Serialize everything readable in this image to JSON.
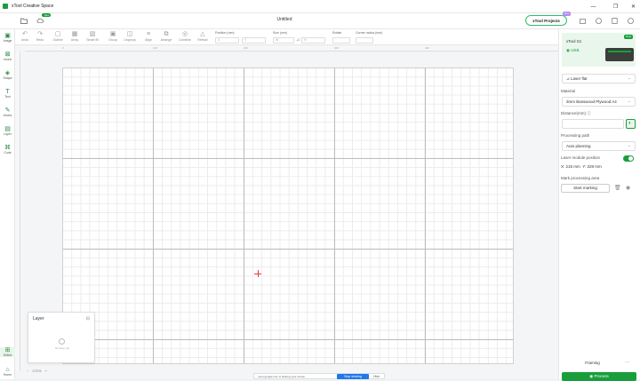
{
  "app": {
    "title": "xTool Creative Space",
    "doc_title": "Untitled",
    "new_badge": "New",
    "projects_label": "xTool Projects",
    "hot_badge": "Hot"
  },
  "window_controls": [
    "—",
    "❐",
    "✕"
  ],
  "toolbar": {
    "items": [
      {
        "label": "Undo",
        "icon": "undo-icon"
      },
      {
        "label": "Redo",
        "icon": "redo-icon"
      },
      {
        "label": "Outline",
        "icon": "outline-icon"
      },
      {
        "label": "Array",
        "icon": "array-icon"
      },
      {
        "label": "Smart fill",
        "icon": "smart-fill-icon"
      },
      {
        "label": "Group",
        "icon": "group-icon"
      },
      {
        "label": "Ungroup",
        "icon": "ungroup-icon"
      },
      {
        "label": "Align",
        "icon": "align-icon"
      },
      {
        "label": "Arrange",
        "icon": "arrange-icon"
      },
      {
        "label": "Combine",
        "icon": "combine-icon"
      },
      {
        "label": "Refract",
        "icon": "refract-icon"
      }
    ],
    "position_label": "Position (mm)",
    "position_x": "X",
    "position_y": "Y",
    "size_label": "Size (mm)",
    "size_w": "W",
    "size_h": "H",
    "rotate_label": "Rotate",
    "corner_label": "Corner radius (mm)"
  },
  "leftbar": {
    "items": [
      {
        "label": "Image",
        "icon": "image-icon"
      },
      {
        "label": "Insert",
        "icon": "insert-icon"
      },
      {
        "label": "Shape",
        "icon": "shape-icon"
      },
      {
        "label": "Text",
        "icon": "text-icon"
      },
      {
        "label": "Vector",
        "icon": "vector-icon"
      },
      {
        "label": "Layer",
        "icon": "layer-icon"
      },
      {
        "label": "Code",
        "icon": "code-icon"
      }
    ],
    "bottom_items": [
      {
        "label": "Select",
        "icon": "select-icon"
      },
      {
        "label": "Home",
        "icon": "home-icon"
      }
    ]
  },
  "rulers": {
    "top_ticks": [
      "0",
      "100",
      "200",
      "300",
      "400"
    ]
  },
  "layer_panel": {
    "title": "Layer",
    "empty_text": "No layer yet"
  },
  "zoom": {
    "minus": "−",
    "value": "272%",
    "plus": "+"
  },
  "notification": {
    "text": "meet.google.com is sharing your screen.",
    "stop_label": "Stop sharing",
    "hide_label": "Hide"
  },
  "right_panel": {
    "device_name": "xTool S1",
    "device_conn": "USB",
    "device_badge": "New",
    "mode": "Laser flat",
    "material_label": "Material",
    "material_value": "3mm Basswood Plywood A4",
    "distance_label": "Distance(mm)",
    "processing_path_label": "Processing path",
    "processing_path_value": "Auto planning",
    "laser_module_label": "Laser module position",
    "laser_module_x": "X: 215 mm",
    "laser_module_y": "Y: 228 mm",
    "mark_area_label": "Mark processing area",
    "start_marking_label": "Start marking",
    "framing_label": "Framing",
    "more_label": "···",
    "process_label": "Process"
  },
  "colors": {
    "accent": "#1a9e3c",
    "crosshair": "#e23b3b",
    "share_btn": "#2079e8"
  }
}
